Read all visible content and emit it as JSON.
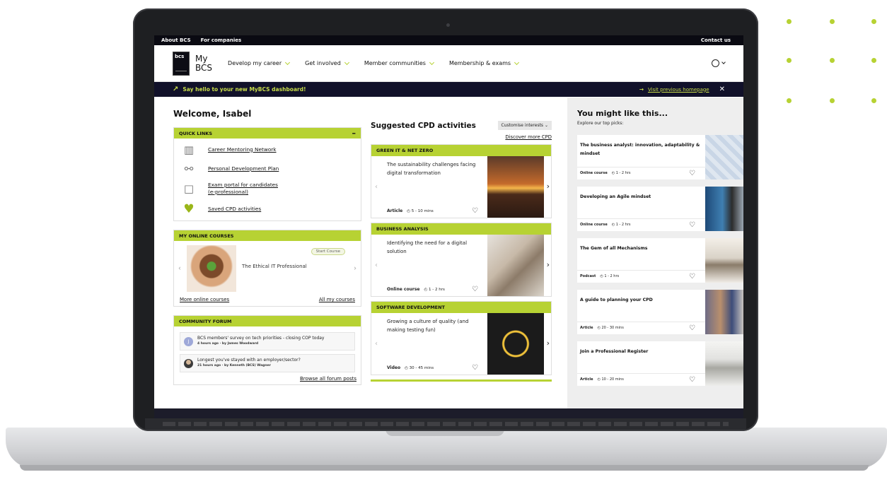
{
  "utility_bar": {
    "about": "About BCS",
    "companies": "For companies",
    "contact": "Contact us"
  },
  "brand": {
    "logo_text": "bcs",
    "my_line1": "My",
    "my_line2": "BCS"
  },
  "nav": {
    "items": [
      "Develop my career",
      "Get involved",
      "Member communities",
      "Membership & exams"
    ]
  },
  "banner": {
    "message": "Say hello to your new MyBCS dashboard!",
    "prev_link": "Visit previous homepage",
    "rocket": "rocket-icon"
  },
  "welcome": "Welcome, Isabel",
  "quick_links": {
    "header": "QUICK LINKS",
    "items": [
      {
        "label": "Career Mentoring Network",
        "icon": "growth-chart-icon"
      },
      {
        "label": "Personal Development Plan",
        "icon": "people-chat-icon"
      },
      {
        "label": "Exam portal for candidates",
        "label2": "(e-professional)",
        "icon": "book-icon"
      },
      {
        "label": "Saved CPD activities",
        "icon": "heart-icon"
      }
    ]
  },
  "online_courses": {
    "header": "MY ONLINE COURSES",
    "course_title": "The Ethical IT Professional",
    "start_label": "Start Course",
    "more_link": "More online courses",
    "all_link": "All my courses"
  },
  "forum": {
    "header": "COMMUNITY FORUM",
    "posts": [
      {
        "avatar": "J",
        "title": "BCS members' survey on tech priorities - closing COP today",
        "meta": "4 hours ago · by James Woodward"
      },
      {
        "avatar": "",
        "title": "Longest you've stayed with an employer/sector?",
        "meta": "21 hours ago · by Kenneth (BCS) Wagner"
      }
    ],
    "browse_link": "Browse all forum posts"
  },
  "suggested": {
    "title": "Suggested CPD activities",
    "customise": "Customise interests",
    "discover": "Discover more CPD",
    "cards": [
      {
        "category": "GREEN IT & NET ZERO",
        "title": "The sustainability challenges facing digital transformation",
        "type": "Article",
        "duration": "5 - 10 mins"
      },
      {
        "category": "BUSINESS ANALYSIS",
        "title": "Identifying the need for a digital solution",
        "type": "Online course",
        "duration": "1 - 2 hrs"
      },
      {
        "category": "SOFTWARE DEVELOPMENT",
        "title": "Growing a culture of quality (and making testing fun)",
        "type": "Video",
        "duration": "30 - 45 mins"
      }
    ]
  },
  "you_might_like": {
    "title": "You might like this...",
    "subtitle": "Explore our top picks:",
    "items": [
      {
        "title": "The business analyst: innovation, adaptability & mindset",
        "type": "Online course",
        "duration": "1 - 2 hrs"
      },
      {
        "title": "Developing an Agile mindset",
        "type": "Online course",
        "duration": "1 - 2 hrs"
      },
      {
        "title": "The Gem of all Mechanisms",
        "type": "Podcast",
        "duration": "1 - 2 hrs"
      },
      {
        "title": "A guide to planning your CPD",
        "type": "Article",
        "duration": "20 - 30 mins"
      },
      {
        "title": "Join a Professional Register",
        "type": "Article",
        "duration": "10 - 20 mins"
      }
    ]
  },
  "colors": {
    "accent": "#b7d233",
    "dark": "#0a0a12",
    "banner": "#11112a"
  }
}
